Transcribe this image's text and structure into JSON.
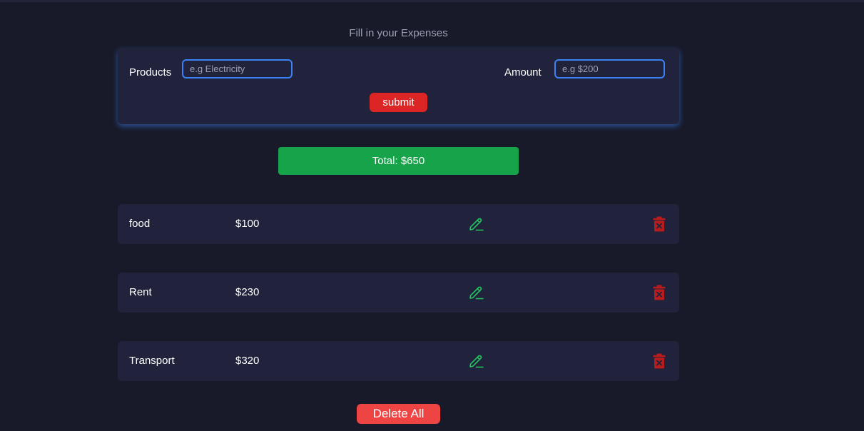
{
  "header": {
    "title": "Fill in your Expenses"
  },
  "form": {
    "products_label": "Products",
    "products_placeholder": "e.g Electricity",
    "products_value": "",
    "amount_label": "Amount",
    "amount_placeholder": "e.g $200",
    "amount_value": "",
    "submit_label": "submit"
  },
  "total": {
    "text": "Total: $650"
  },
  "expenses": [
    {
      "name": "food",
      "amount": "$100"
    },
    {
      "name": "Rent",
      "amount": "$230"
    },
    {
      "name": "Transport",
      "amount": "$320"
    }
  ],
  "icons": {
    "edit": "pencil-icon",
    "delete": "trash-icon"
  },
  "colors": {
    "background": "#181a29",
    "card": "#21233c",
    "accent_blue": "#3b82f6",
    "submit_red": "#dc2626",
    "delete_all_red": "#ef4444",
    "total_green": "#16a34a",
    "edit_green": "#22c55e",
    "trash_red": "#b91c1c"
  },
  "footer": {
    "delete_all_label": "Delete All"
  }
}
